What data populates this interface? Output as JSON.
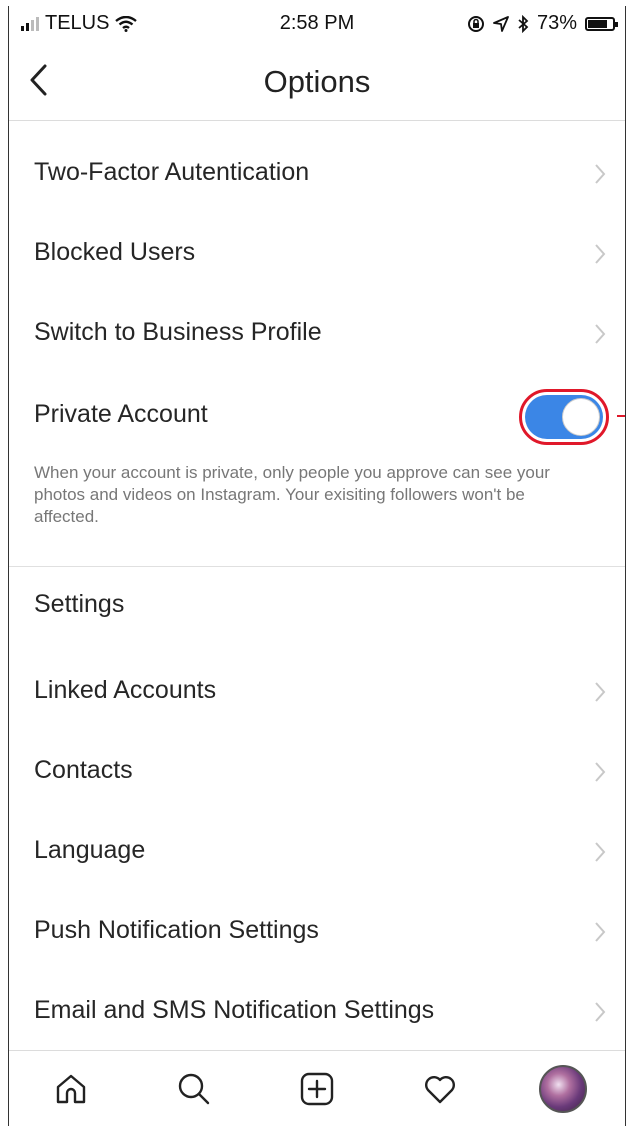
{
  "status_bar": {
    "carrier": "TELUS",
    "time": "2:58 PM",
    "battery_percent": "73%",
    "battery_level": 0.73,
    "icons": [
      "signal-icon",
      "wifi-icon",
      "moon-icon",
      "rotation-lock-icon",
      "location-icon",
      "bluetooth-icon",
      "battery-icon"
    ]
  },
  "nav": {
    "title": "Options",
    "back_icon": "chevron-left-icon"
  },
  "privacy_items": [
    {
      "label": "Two-Factor Autentication"
    },
    {
      "label": "Blocked Users"
    },
    {
      "label": "Switch to Business Profile"
    }
  ],
  "private_account": {
    "label": "Private Account",
    "enabled": true,
    "toggle_color": "#3b86e6",
    "highlight_color": "#e0182a",
    "description": "When your account is private, only people you approve can see your photos and videos on Instagram. Your exisiting followers won't be affected."
  },
  "settings": {
    "title": "Settings",
    "items": [
      {
        "label": "Linked Accounts"
      },
      {
        "label": "Contacts"
      },
      {
        "label": "Language"
      },
      {
        "label": "Push Notification Settings"
      },
      {
        "label": "Email and SMS Notification Settings"
      }
    ]
  },
  "tab_bar": {
    "tabs": [
      "home-icon",
      "search-icon",
      "add-post-icon",
      "activity-heart-icon",
      "profile-avatar"
    ]
  }
}
